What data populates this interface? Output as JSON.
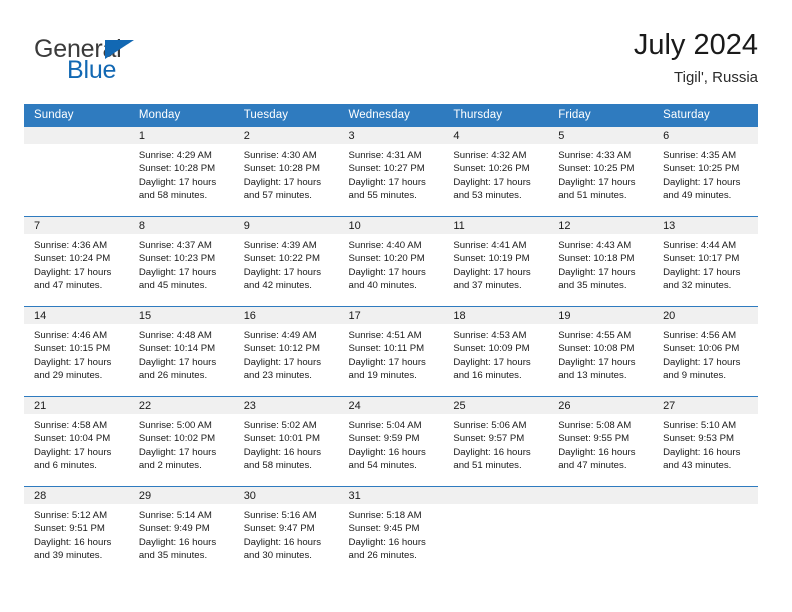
{
  "brand": {
    "name_part1": "General",
    "name_part2": "Blue"
  },
  "header": {
    "title": "July 2024",
    "subtitle": "Tigil', Russia"
  },
  "weekdays": [
    "Sunday",
    "Monday",
    "Tuesday",
    "Wednesday",
    "Thursday",
    "Friday",
    "Saturday"
  ],
  "colors": {
    "header_blue": "#2f7bbf",
    "brand_blue": "#1268b3",
    "daynum_band": "#f0f0f0"
  },
  "labels": {
    "sunrise_prefix": "Sunrise:",
    "sunset_prefix": "Sunset:",
    "daylight_prefix": "Daylight:"
  },
  "weeks": [
    [
      {
        "day": ""
      },
      {
        "day": "1",
        "sunrise": "Sunrise: 4:29 AM",
        "sunset": "Sunset: 10:28 PM",
        "daylight1": "Daylight: 17 hours",
        "daylight2": "and 58 minutes."
      },
      {
        "day": "2",
        "sunrise": "Sunrise: 4:30 AM",
        "sunset": "Sunset: 10:28 PM",
        "daylight1": "Daylight: 17 hours",
        "daylight2": "and 57 minutes."
      },
      {
        "day": "3",
        "sunrise": "Sunrise: 4:31 AM",
        "sunset": "Sunset: 10:27 PM",
        "daylight1": "Daylight: 17 hours",
        "daylight2": "and 55 minutes."
      },
      {
        "day": "4",
        "sunrise": "Sunrise: 4:32 AM",
        "sunset": "Sunset: 10:26 PM",
        "daylight1": "Daylight: 17 hours",
        "daylight2": "and 53 minutes."
      },
      {
        "day": "5",
        "sunrise": "Sunrise: 4:33 AM",
        "sunset": "Sunset: 10:25 PM",
        "daylight1": "Daylight: 17 hours",
        "daylight2": "and 51 minutes."
      },
      {
        "day": "6",
        "sunrise": "Sunrise: 4:35 AM",
        "sunset": "Sunset: 10:25 PM",
        "daylight1": "Daylight: 17 hours",
        "daylight2": "and 49 minutes."
      }
    ],
    [
      {
        "day": "7",
        "sunrise": "Sunrise: 4:36 AM",
        "sunset": "Sunset: 10:24 PM",
        "daylight1": "Daylight: 17 hours",
        "daylight2": "and 47 minutes."
      },
      {
        "day": "8",
        "sunrise": "Sunrise: 4:37 AM",
        "sunset": "Sunset: 10:23 PM",
        "daylight1": "Daylight: 17 hours",
        "daylight2": "and 45 minutes."
      },
      {
        "day": "9",
        "sunrise": "Sunrise: 4:39 AM",
        "sunset": "Sunset: 10:22 PM",
        "daylight1": "Daylight: 17 hours",
        "daylight2": "and 42 minutes."
      },
      {
        "day": "10",
        "sunrise": "Sunrise: 4:40 AM",
        "sunset": "Sunset: 10:20 PM",
        "daylight1": "Daylight: 17 hours",
        "daylight2": "and 40 minutes."
      },
      {
        "day": "11",
        "sunrise": "Sunrise: 4:41 AM",
        "sunset": "Sunset: 10:19 PM",
        "daylight1": "Daylight: 17 hours",
        "daylight2": "and 37 minutes."
      },
      {
        "day": "12",
        "sunrise": "Sunrise: 4:43 AM",
        "sunset": "Sunset: 10:18 PM",
        "daylight1": "Daylight: 17 hours",
        "daylight2": "and 35 minutes."
      },
      {
        "day": "13",
        "sunrise": "Sunrise: 4:44 AM",
        "sunset": "Sunset: 10:17 PM",
        "daylight1": "Daylight: 17 hours",
        "daylight2": "and 32 minutes."
      }
    ],
    [
      {
        "day": "14",
        "sunrise": "Sunrise: 4:46 AM",
        "sunset": "Sunset: 10:15 PM",
        "daylight1": "Daylight: 17 hours",
        "daylight2": "and 29 minutes."
      },
      {
        "day": "15",
        "sunrise": "Sunrise: 4:48 AM",
        "sunset": "Sunset: 10:14 PM",
        "daylight1": "Daylight: 17 hours",
        "daylight2": "and 26 minutes."
      },
      {
        "day": "16",
        "sunrise": "Sunrise: 4:49 AM",
        "sunset": "Sunset: 10:12 PM",
        "daylight1": "Daylight: 17 hours",
        "daylight2": "and 23 minutes."
      },
      {
        "day": "17",
        "sunrise": "Sunrise: 4:51 AM",
        "sunset": "Sunset: 10:11 PM",
        "daylight1": "Daylight: 17 hours",
        "daylight2": "and 19 minutes."
      },
      {
        "day": "18",
        "sunrise": "Sunrise: 4:53 AM",
        "sunset": "Sunset: 10:09 PM",
        "daylight1": "Daylight: 17 hours",
        "daylight2": "and 16 minutes."
      },
      {
        "day": "19",
        "sunrise": "Sunrise: 4:55 AM",
        "sunset": "Sunset: 10:08 PM",
        "daylight1": "Daylight: 17 hours",
        "daylight2": "and 13 minutes."
      },
      {
        "day": "20",
        "sunrise": "Sunrise: 4:56 AM",
        "sunset": "Sunset: 10:06 PM",
        "daylight1": "Daylight: 17 hours",
        "daylight2": "and 9 minutes."
      }
    ],
    [
      {
        "day": "21",
        "sunrise": "Sunrise: 4:58 AM",
        "sunset": "Sunset: 10:04 PM",
        "daylight1": "Daylight: 17 hours",
        "daylight2": "and 6 minutes."
      },
      {
        "day": "22",
        "sunrise": "Sunrise: 5:00 AM",
        "sunset": "Sunset: 10:02 PM",
        "daylight1": "Daylight: 17 hours",
        "daylight2": "and 2 minutes."
      },
      {
        "day": "23",
        "sunrise": "Sunrise: 5:02 AM",
        "sunset": "Sunset: 10:01 PM",
        "daylight1": "Daylight: 16 hours",
        "daylight2": "and 58 minutes."
      },
      {
        "day": "24",
        "sunrise": "Sunrise: 5:04 AM",
        "sunset": "Sunset: 9:59 PM",
        "daylight1": "Daylight: 16 hours",
        "daylight2": "and 54 minutes."
      },
      {
        "day": "25",
        "sunrise": "Sunrise: 5:06 AM",
        "sunset": "Sunset: 9:57 PM",
        "daylight1": "Daylight: 16 hours",
        "daylight2": "and 51 minutes."
      },
      {
        "day": "26",
        "sunrise": "Sunrise: 5:08 AM",
        "sunset": "Sunset: 9:55 PM",
        "daylight1": "Daylight: 16 hours",
        "daylight2": "and 47 minutes."
      },
      {
        "day": "27",
        "sunrise": "Sunrise: 5:10 AM",
        "sunset": "Sunset: 9:53 PM",
        "daylight1": "Daylight: 16 hours",
        "daylight2": "and 43 minutes."
      }
    ],
    [
      {
        "day": "28",
        "sunrise": "Sunrise: 5:12 AM",
        "sunset": "Sunset: 9:51 PM",
        "daylight1": "Daylight: 16 hours",
        "daylight2": "and 39 minutes."
      },
      {
        "day": "29",
        "sunrise": "Sunrise: 5:14 AM",
        "sunset": "Sunset: 9:49 PM",
        "daylight1": "Daylight: 16 hours",
        "daylight2": "and 35 minutes."
      },
      {
        "day": "30",
        "sunrise": "Sunrise: 5:16 AM",
        "sunset": "Sunset: 9:47 PM",
        "daylight1": "Daylight: 16 hours",
        "daylight2": "and 30 minutes."
      },
      {
        "day": "31",
        "sunrise": "Sunrise: 5:18 AM",
        "sunset": "Sunset: 9:45 PM",
        "daylight1": "Daylight: 16 hours",
        "daylight2": "and 26 minutes."
      },
      {
        "day": ""
      },
      {
        "day": ""
      },
      {
        "day": ""
      }
    ]
  ]
}
